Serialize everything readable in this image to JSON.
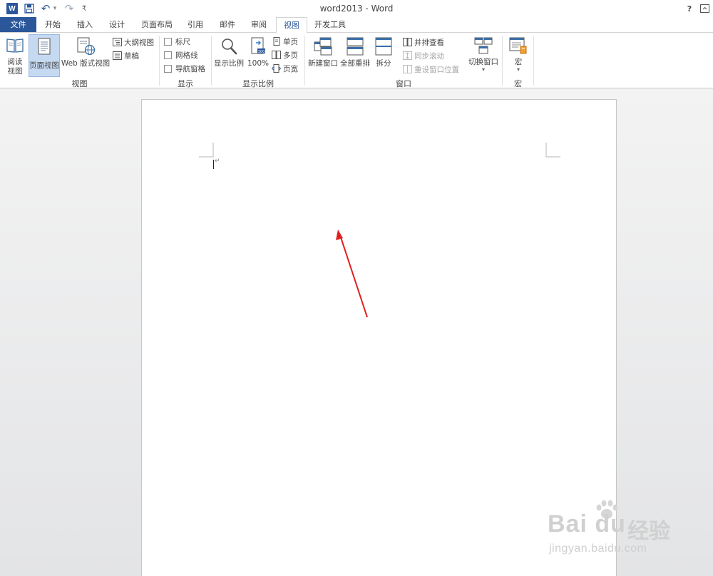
{
  "window": {
    "title": "word2013 - Word",
    "help": "?",
    "logo_letter": "W"
  },
  "quick_access": {
    "save": "save-icon",
    "undo": "↶",
    "undo_dropdown": "▾",
    "redo": "↷",
    "customize": "₹"
  },
  "tabs": [
    "文件",
    "开始",
    "插入",
    "设计",
    "页面布局",
    "引用",
    "邮件",
    "审阅",
    "视图",
    "开发工具"
  ],
  "active_tab": "视图",
  "ribbon": {
    "views": {
      "label": "视图",
      "read_mode": [
        "阅读",
        "视图"
      ],
      "print_layout": "页面视图",
      "web_layout": "Web 版式视图",
      "outline": "大纲视图",
      "draft": "草稿"
    },
    "show": {
      "label": "显示",
      "ruler": "标尺",
      "gridlines": "网格线",
      "nav_pane": "导航窗格"
    },
    "zoom": {
      "label": "显示比例",
      "zoom": "显示比例",
      "hundred": "100%",
      "one_page": "单页",
      "multi_page": "多页",
      "page_width": "页宽"
    },
    "window": {
      "label": "窗口",
      "new_window": "新建窗口",
      "arrange_all": "全部重排",
      "split": "拆分",
      "side_by_side": "并排查看",
      "sync_scroll": "同步滚动",
      "reset_position": "重设窗口位置",
      "switch_windows": "切换窗口",
      "dropdown": "▾"
    },
    "macros": {
      "label": "宏",
      "macros": "宏",
      "dropdown": "▾"
    }
  },
  "document": {
    "paragraph_mark": "↵"
  },
  "watermark": {
    "brand": "Bai du",
    "cn": "经验",
    "url": "jingyan.baidu.com"
  },
  "colors": {
    "accent": "#2b579a",
    "arrow": "#e02020"
  }
}
